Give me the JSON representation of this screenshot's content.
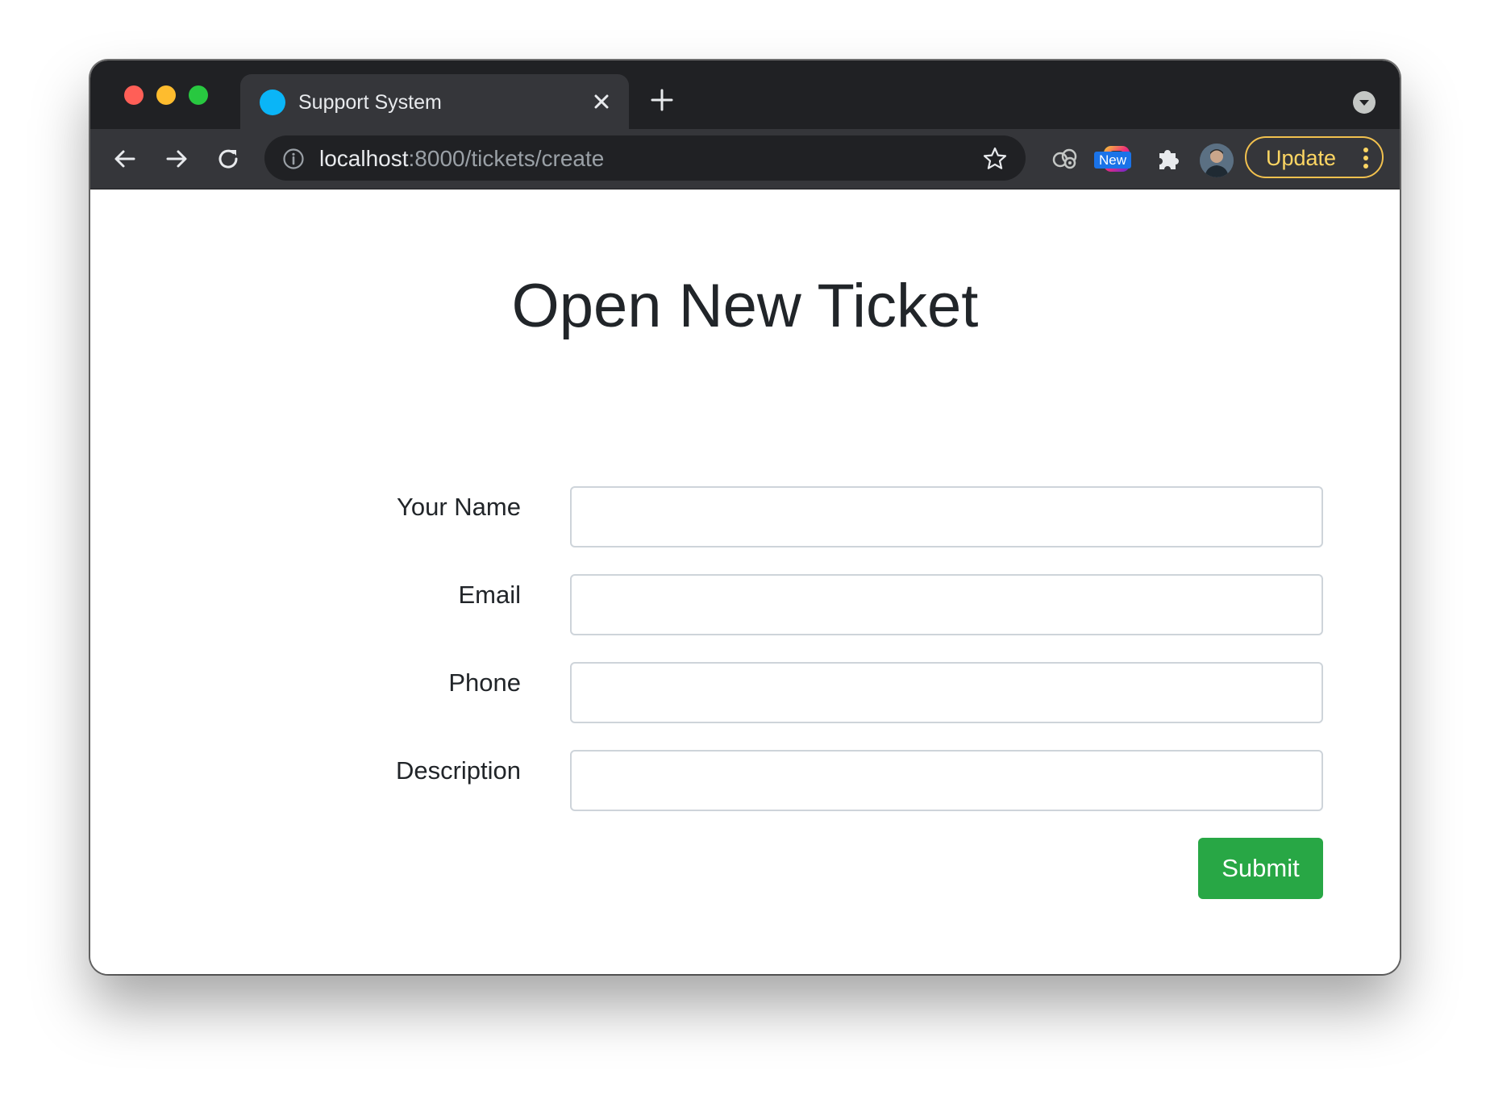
{
  "browser": {
    "tab": {
      "title": "Support System"
    },
    "address_bar": {
      "host": "localhost",
      "path": ":8000/tickets/create"
    },
    "extensions": {
      "new_badge": "New"
    },
    "update_button": {
      "label": "Update"
    },
    "colors": {
      "favicon": "#0ab5f7",
      "update_accent": "#fdd663",
      "new_badge": "#1a73e8"
    },
    "icons": [
      "back-arrow-icon",
      "forward-arrow-icon",
      "reload-icon",
      "info-icon",
      "star-icon",
      "extension-icon",
      "puzzle-icon",
      "kebab-menu-icon",
      "close-icon",
      "plus-icon"
    ]
  },
  "page": {
    "title": "Open New Ticket",
    "form": {
      "fields": [
        {
          "label": "Your Name",
          "value": "",
          "placeholder": ""
        },
        {
          "label": "Email",
          "value": "",
          "placeholder": ""
        },
        {
          "label": "Phone",
          "value": "",
          "placeholder": ""
        },
        {
          "label": "Description",
          "value": "",
          "placeholder": ""
        }
      ],
      "submit_label": "Submit"
    },
    "colors": {
      "submit_button": "#28a745",
      "text": "#212529"
    }
  }
}
